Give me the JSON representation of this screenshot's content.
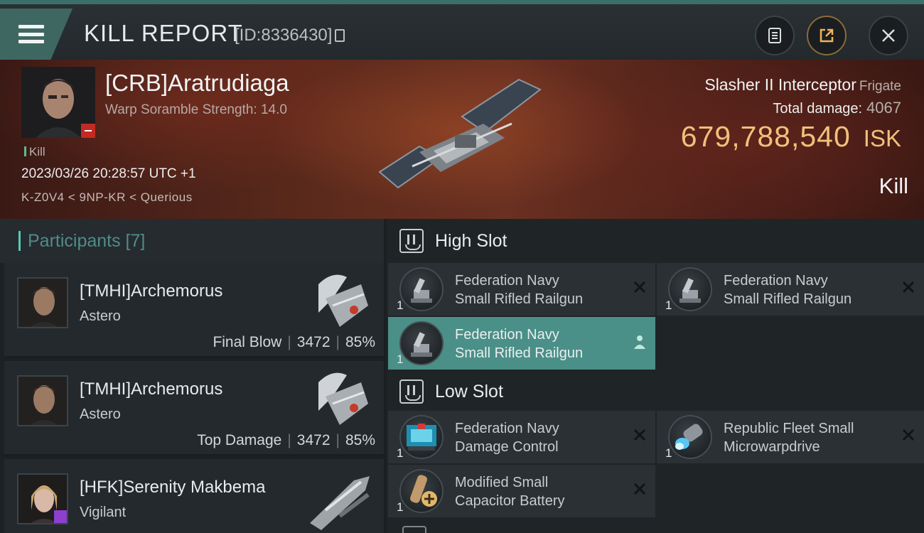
{
  "header": {
    "title": "KILL REPORT",
    "report_id": "[ID:8336430]",
    "menu_icon": "hamburger-menu-icon",
    "buttons": [
      "clipboard-icon",
      "share-icon",
      "close-icon"
    ],
    "accent": "#3f6762"
  },
  "victim": {
    "name": "[CRB]Aratrudiaga",
    "warp_scramble": "Warp Soramble Strength: 14.0",
    "tag": "Kill",
    "time": "2023/03/26 20:28:57 UTC +1",
    "location": "K-Z0V4 < 9NP-KR < Querious",
    "ship": "Slasher II Interceptor",
    "ship_class": "Frigate",
    "total_damage_label": "Total damage:",
    "total_damage": "4067",
    "isk_value": "679,788,540",
    "isk_unit": "ISK",
    "result": "Kill",
    "isk_color": "#f1c07c"
  },
  "participants": {
    "label": "Participants [7]",
    "rows": [
      {
        "name": "[TMHI]Archemorus",
        "ship": "Astero",
        "role": "Final Blow",
        "damage": "3472",
        "percent": "85%"
      },
      {
        "name": "[TMHI]Archemorus",
        "ship": "Astero",
        "role": "Top Damage",
        "damage": "3472",
        "percent": "85%"
      },
      {
        "name": "[HFK]Serenity Makbema",
        "ship": "Vigilant"
      }
    ]
  },
  "fitting": {
    "high_slot_label": "High Slot",
    "low_slot_label": "Low Slot",
    "high": [
      {
        "qty": "1",
        "line1": "Federation Navy",
        "line2": "Small Rifled Railgun"
      },
      {
        "qty": "1",
        "line1": "Federation Navy",
        "line2": "Small Rifled Railgun"
      },
      {
        "qty": "1",
        "line1": "Federation Navy",
        "line2": "Small Rifled Railgun"
      }
    ],
    "low": [
      {
        "qty": "1",
        "line1": "Federation Navy",
        "line2": "Damage Control"
      },
      {
        "qty": "1",
        "line1": "Republic Fleet Small",
        "line2": "Microwarpdrive"
      },
      {
        "qty": "1",
        "line1": "Modified Small",
        "line2": "Capacitor Battery"
      }
    ]
  }
}
